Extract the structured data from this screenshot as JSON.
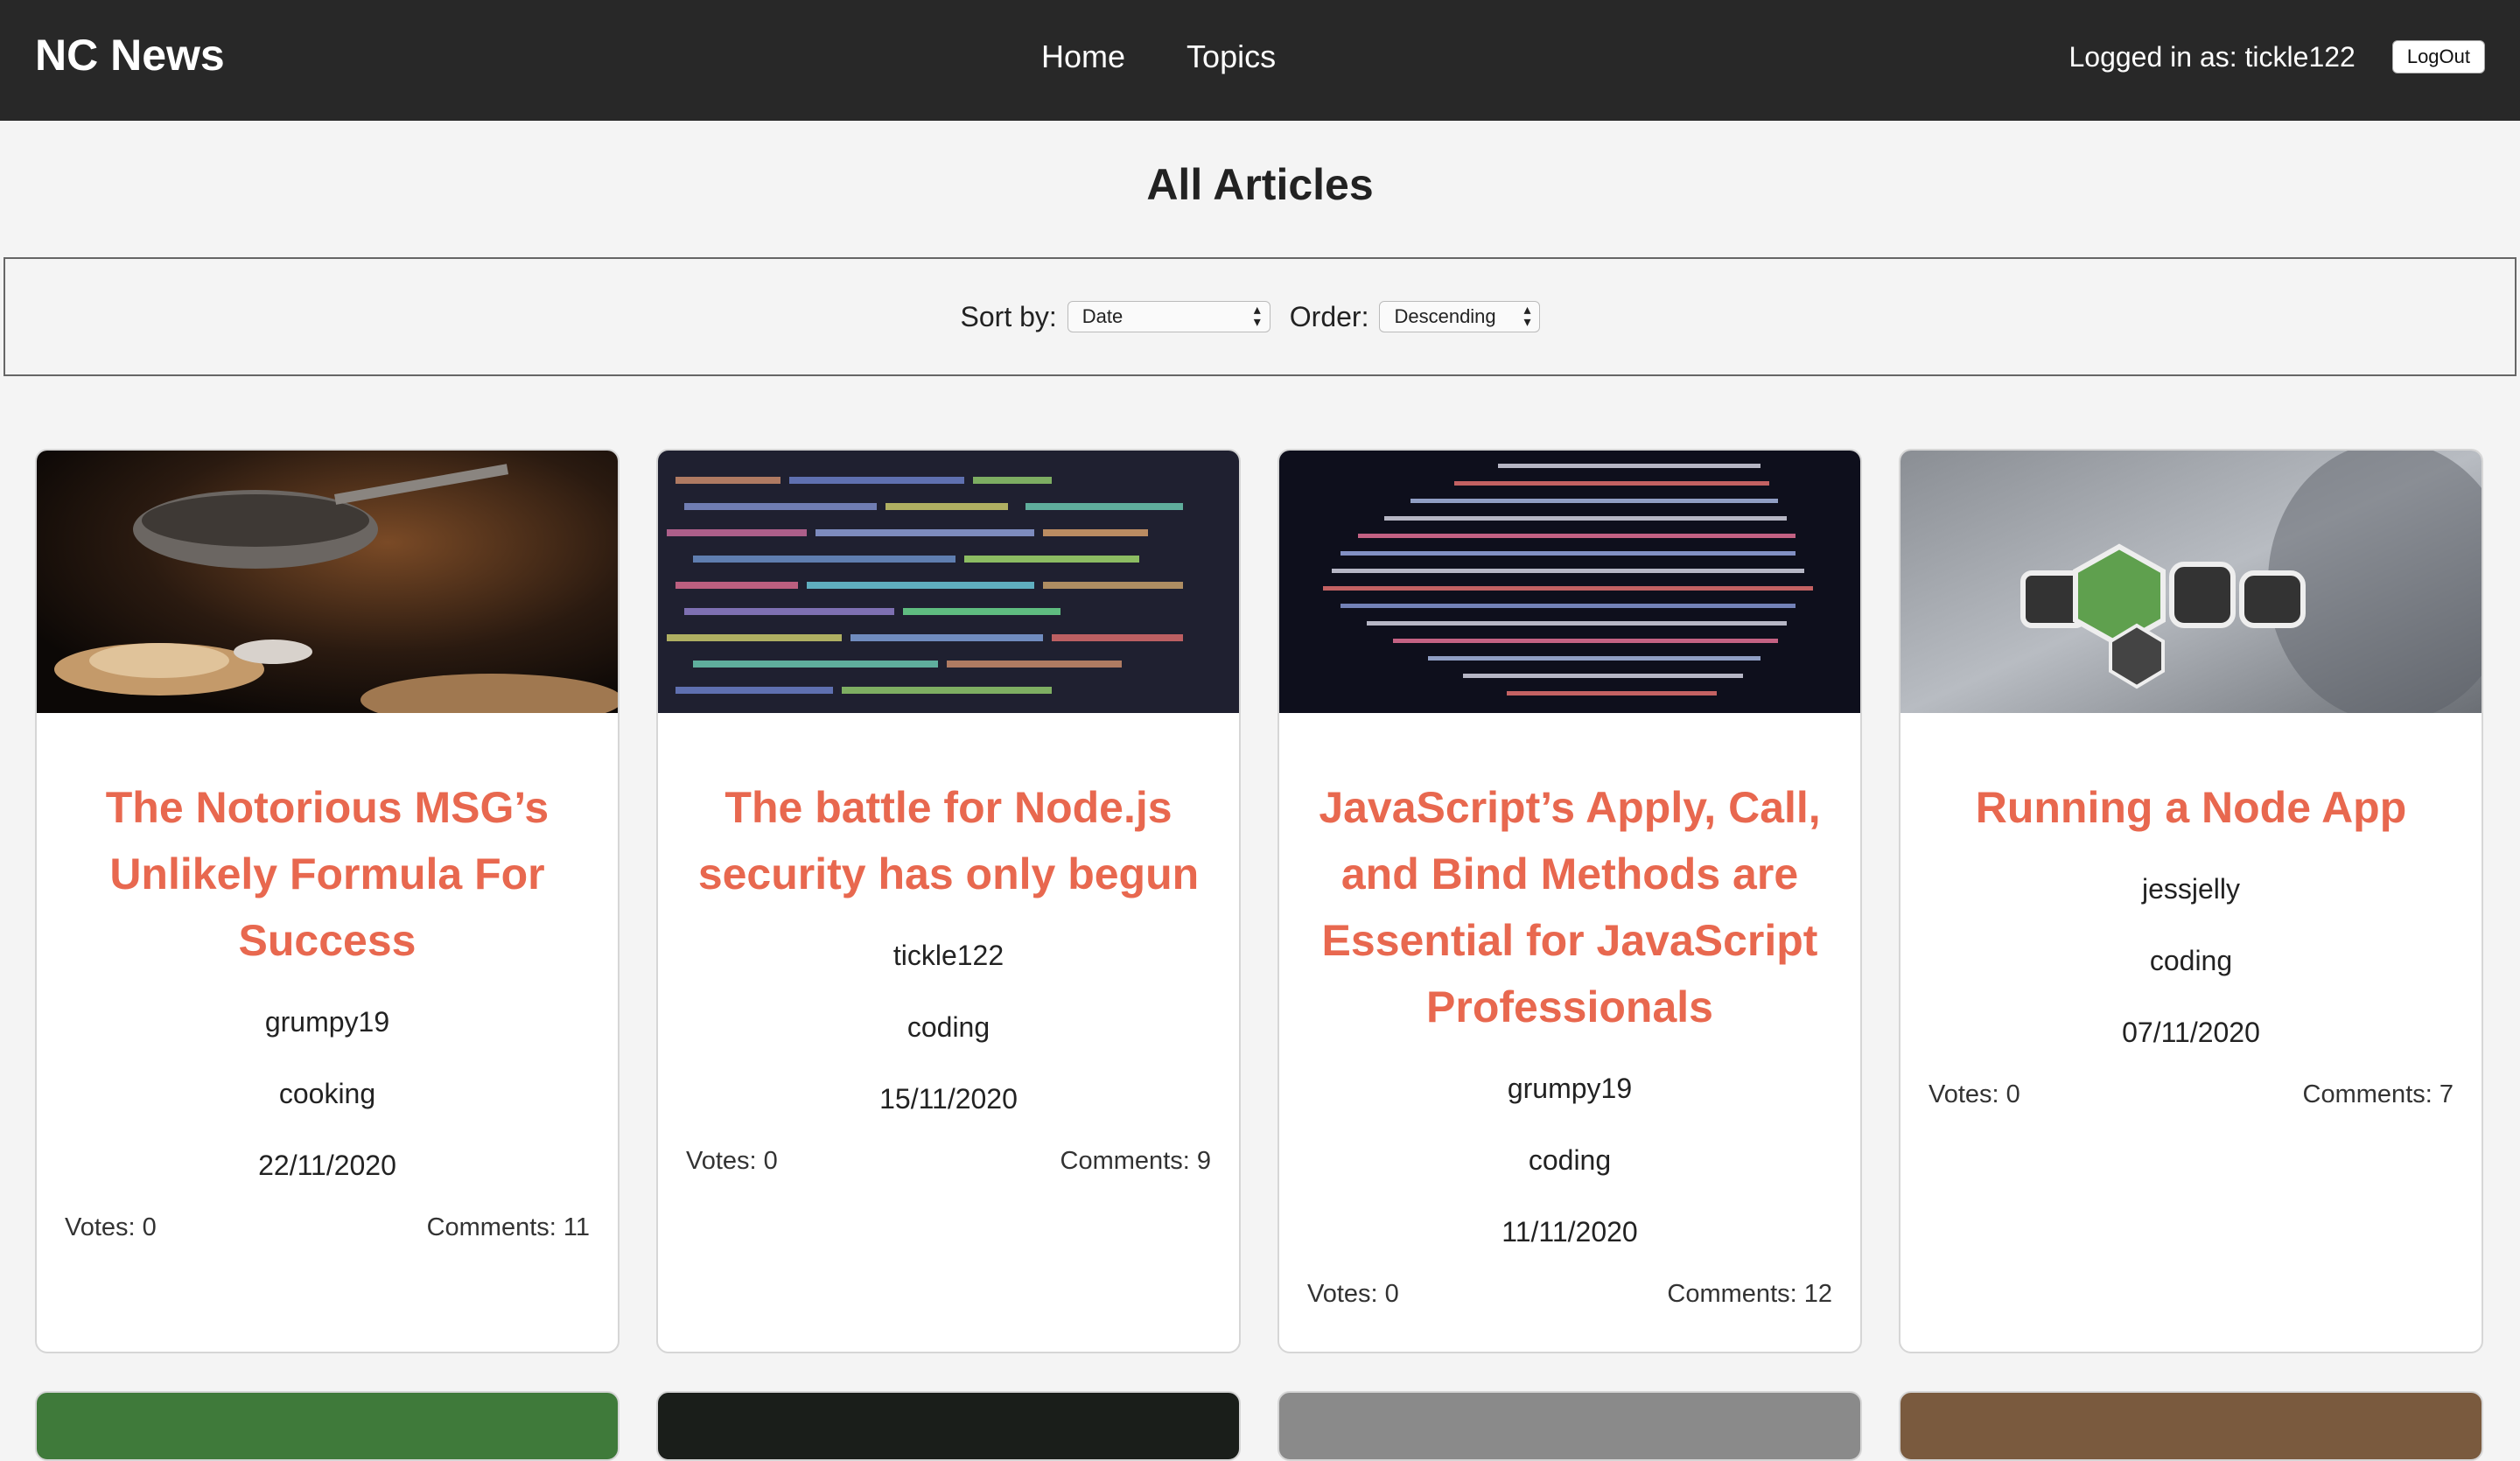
{
  "nav": {
    "brand": "NC News",
    "links": [
      "Home",
      "Topics"
    ],
    "user_text": "Logged in as: tickle122",
    "logout_label": "LogOut"
  },
  "page": {
    "title": "All Articles"
  },
  "sort": {
    "sort_label": "Sort by:",
    "sort_value": "Date",
    "order_label": "Order:",
    "order_value": "Descending"
  },
  "articles": [
    {
      "title": "The Notorious MSG’s Unlikely Formula For Success",
      "author": "grumpy19",
      "topic": "cooking",
      "date": "22/11/2020",
      "votes": "Votes: 0",
      "comments": "Comments: 11"
    },
    {
      "title": "The battle for Node.js security has only begun",
      "author": "tickle122",
      "topic": "coding",
      "date": "15/11/2020",
      "votes": "Votes: 0",
      "comments": "Comments: 9"
    },
    {
      "title": "JavaScript’s Apply, Call, and Bind Methods are Essential for JavaScript Professionals",
      "author": "grumpy19",
      "topic": "coding",
      "date": "11/11/2020",
      "votes": "Votes: 0",
      "comments": "Comments: 12"
    },
    {
      "title": "Running a Node App",
      "author": "jessjelly",
      "topic": "coding",
      "date": "07/11/2020",
      "votes": "Votes: 0",
      "comments": "Comments: 7"
    }
  ],
  "colors": {
    "navbar": "#282828",
    "title_accent": "#e8684f",
    "background": "#f4f4f4"
  }
}
